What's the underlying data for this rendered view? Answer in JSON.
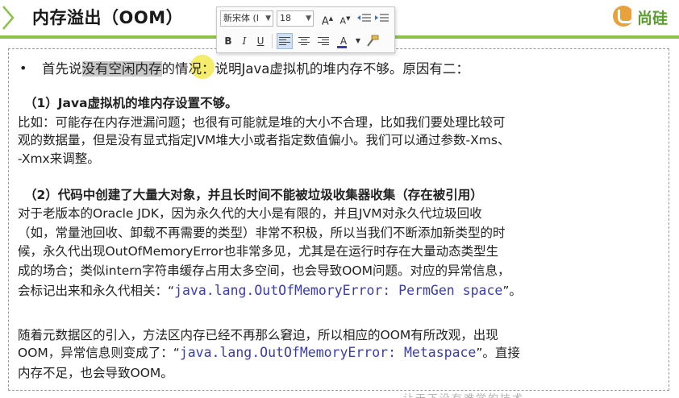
{
  "slide": {
    "title": "内存溢出（OOM）",
    "logo_text": "尚硅"
  },
  "toolbar": {
    "font_name": "新宋体 (I",
    "font_size": "18",
    "grow_font": "A",
    "shrink_font": "A",
    "bold": "B",
    "italic": "I",
    "underline": "U",
    "font_color": "A"
  },
  "content": {
    "bullet": {
      "prefix": "首先说",
      "highlight": "没有空闲内存",
      "suffix": "的情况：说明Java虚拟机的堆内存不够。原因有二："
    },
    "h1": "（1）Java虚拟机的堆内存设置不够。",
    "p1": [
      "比如：可能存在内存泄漏问题；也很有可能就是堆的大小不合理，比如我们要处理比较可",
      "观的数据量，但是没有显式指定JVM堆大小或者指定数值偏小。我们可以通过参数-Xms、",
      "-Xmx来调整。"
    ],
    "h2": "（2）代码中创建了大量大对象，并且长时间不能被垃圾收集器收集（存在被引用）",
    "p2": [
      "对于老版本的Oracle JDK，因为永久代的大小是有限的，并且JVM对永久代垃圾回收",
      "（如，常量池回收、卸载不再需要的类型）非常不积极，所以当我们不断添加新类型的时",
      "候，永久代出现OutOfMemoryError也非常多见，尤其是在运行时存在大量动态类型生",
      "成的场合；类似intern字符串缓存占用太多空间，也会导致OOM问题。对应的异常信息，"
    ],
    "p2_last_prefix": "会标记出来和永久代相关：“",
    "p2_code": "java.lang.OutOfMemoryError: PermGen space",
    "p2_last_suffix": "”。",
    "p3_line1": "随着元数据区的引入，方法区内存已经不再那么窘迫，所以相应的OOM有所改观，出现",
    "p3_line2_prefix": "OOM，异常信息则变成了：“",
    "p3_code": "java.lang.OutOfMemoryError: Metaspace",
    "p3_line2_suffix": "”。直接",
    "p3_line3": "内存不足，也会导致OOM。"
  },
  "watermark": "让天下没有难学的技术"
}
